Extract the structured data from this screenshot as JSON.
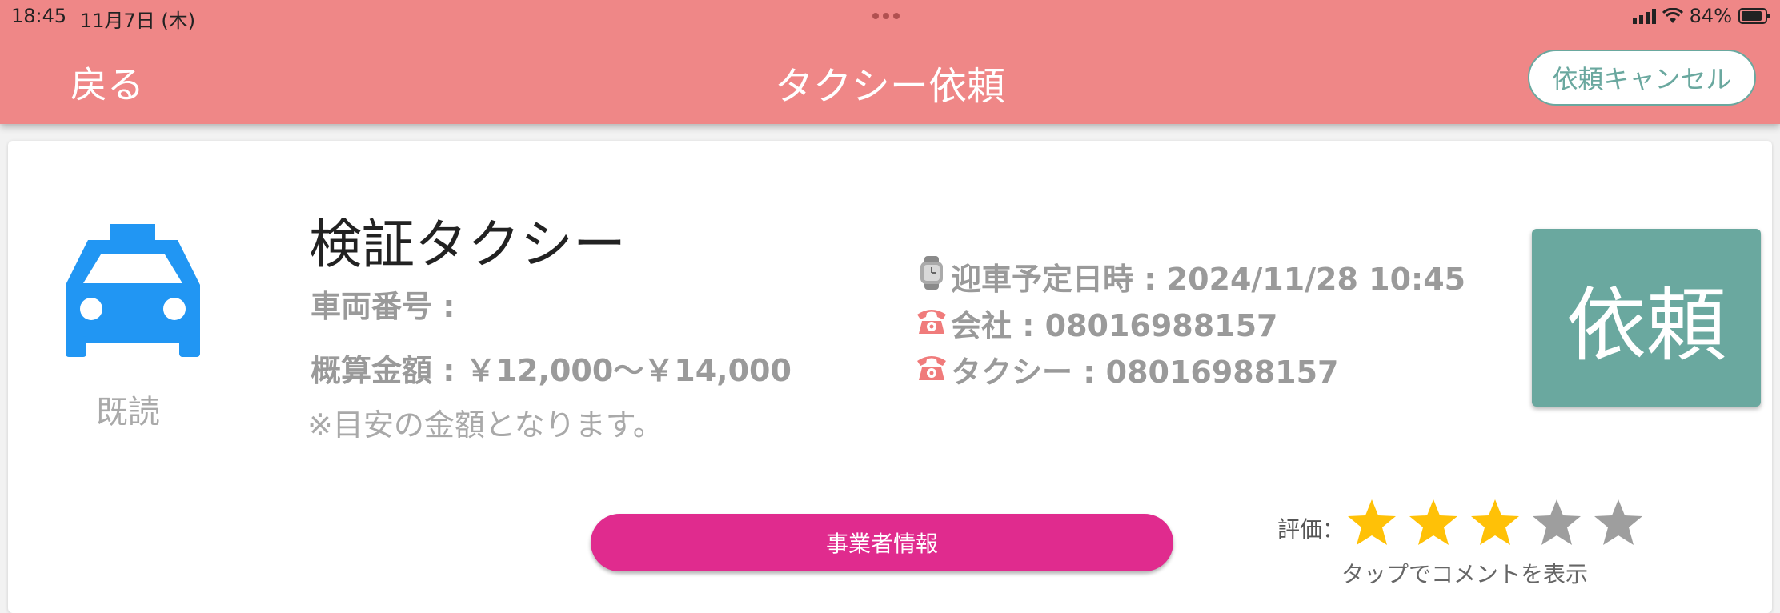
{
  "status_bar": {
    "time": "18:45",
    "date": "11月7日 (木)",
    "battery": "84%"
  },
  "header": {
    "back_label": "戻る",
    "title": "タクシー依頼",
    "cancel_label": "依頼キャンセル"
  },
  "card": {
    "read_status": "既読",
    "company_name": "検証タクシー",
    "vehicle_number": "車両番号 :",
    "estimated_fare": "概算金額 : ￥12,000～￥14,000",
    "note": "※目安の金額となります。",
    "pickup_datetime": "迎車予定日時 : 2024/11/28 10:45",
    "company_phone": "会社 : 08016988157",
    "taxi_phone": "タクシー : 08016988157",
    "request_label": "依頼",
    "operator_info_label": "事業者情報",
    "rating_label": "評価：",
    "rating_value": 3,
    "rating_max": 5,
    "rating_hint": "タップでコメントを表示"
  },
  "colors": {
    "header_bg": "#ef8787",
    "accent_teal": "#6aa89f",
    "taxi_blue": "#2196f3",
    "operator_pink": "#e02b8e",
    "star_filled": "#ffc107",
    "star_empty": "#9e9e9e"
  },
  "icons": [
    "signal-icon",
    "wifi-icon",
    "battery-icon",
    "taxi-icon",
    "watch-icon",
    "phone-icon",
    "star-icon"
  ]
}
